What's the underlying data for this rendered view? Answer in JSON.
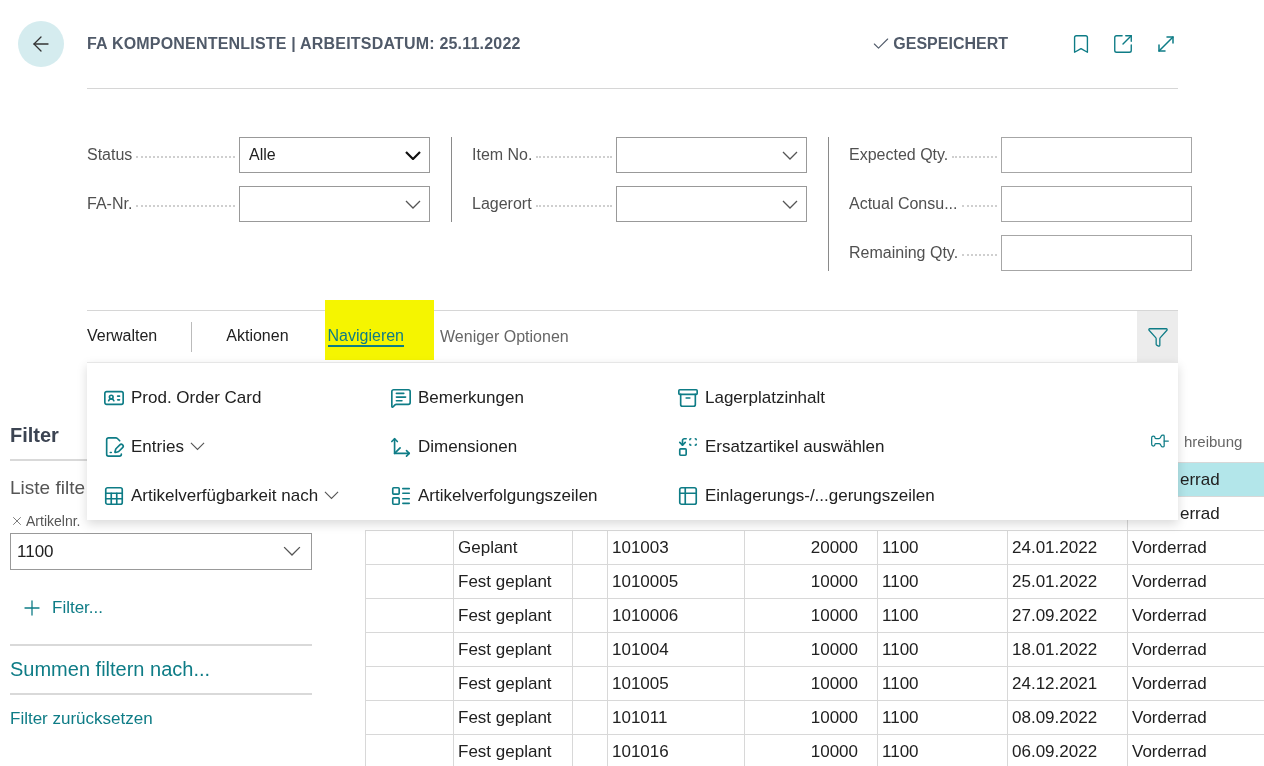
{
  "header": {
    "title": "FA KOMPONENTENLISTE | ARBEITSDATUM: 25.11.2022",
    "save_status": "GESPEICHERT"
  },
  "field_groups": [
    [
      {
        "label": "Status",
        "kind": "select",
        "value": "Alle"
      },
      {
        "label": "FA-Nr.",
        "kind": "select"
      }
    ],
    [
      {
        "label": "Item No.",
        "kind": "select"
      },
      {
        "label": "Lagerort",
        "kind": "select"
      }
    ],
    [
      {
        "label": "Expected Qty.",
        "kind": "text"
      },
      {
        "label": "Actual Consu...",
        "kind": "text"
      },
      {
        "label": "Remaining Qty.",
        "kind": "text"
      }
    ]
  ],
  "action_tabs": [
    {
      "label": "Verwalten",
      "selected": false,
      "highlighted": false
    },
    {
      "label": "Aktionen",
      "selected": false,
      "highlighted": false
    },
    {
      "label": "Navigieren",
      "selected": true,
      "highlighted": true
    }
  ],
  "less_options": "Weniger Optionen",
  "menu": {
    "columns": [
      [
        {
          "label": "Prod. Order Card",
          "expandable": false
        },
        {
          "label": "Entries",
          "expandable": true
        },
        {
          "label": "Artikelverfügbarkeit nach",
          "expandable": true
        }
      ],
      [
        {
          "label": "Bemerkungen",
          "expandable": false
        },
        {
          "label": "Dimensionen",
          "expandable": false
        },
        {
          "label": "Artikelverfolgungszeilen",
          "expandable": false
        }
      ],
      [
        {
          "label": "Lagerplatzinhalt",
          "expandable": false
        },
        {
          "label": "Ersatzartikel auswählen",
          "expandable": false
        },
        {
          "label": "Einlagerungs-/...gerungszeilen",
          "expandable": false
        }
      ]
    ]
  },
  "filter_pane": {
    "title": "Filter",
    "list_filter": "Liste filte",
    "filter_field": {
      "label": "Artikelnr.",
      "value": "1100"
    },
    "add_filter": "Filter...",
    "totals": "Summen filtern nach...",
    "reset": "Filter zurücksetzen"
  },
  "table": {
    "column_8_header": "hreibung",
    "rows": [
      {
        "selected": true,
        "cells": {
          "column_8": "errad"
        }
      },
      {
        "selected": false,
        "cells": {
          "column_8": "errad"
        }
      },
      {
        "selected": false,
        "cells": {
          "column_2": "Geplant",
          "column_4": "101003",
          "column_5": "20000",
          "column_6": "1100",
          "column_7": "24.01.2022",
          "column_8": "Vorderrad"
        }
      },
      {
        "selected": false,
        "cells": {
          "column_2": "Fest geplant",
          "column_4": "1010005",
          "column_5": "10000",
          "column_6": "1100",
          "column_7": "25.01.2022",
          "column_8": "Vorderrad"
        }
      },
      {
        "selected": false,
        "cells": {
          "column_2": "Fest geplant",
          "column_4": "1010006",
          "column_5": "10000",
          "column_6": "1100",
          "column_7": "27.09.2022",
          "column_8": "Vorderrad"
        }
      },
      {
        "selected": false,
        "cells": {
          "column_2": "Fest geplant",
          "column_4": "101004",
          "column_5": "10000",
          "column_6": "1100",
          "column_7": "18.01.2022",
          "column_8": "Vorderrad"
        }
      },
      {
        "selected": false,
        "cells": {
          "column_2": "Fest geplant",
          "column_4": "101005",
          "column_5": "10000",
          "column_6": "1100",
          "column_7": "24.12.2021",
          "column_8": "Vorderrad"
        }
      },
      {
        "selected": false,
        "cells": {
          "column_2": "Fest geplant",
          "column_4": "101011",
          "column_5": "10000",
          "column_6": "1100",
          "column_7": "08.09.2022",
          "column_8": "Vorderrad"
        }
      },
      {
        "selected": false,
        "cells": {
          "column_2": "Fest geplant",
          "column_4": "101016",
          "column_5": "10000",
          "column_6": "1100",
          "column_7": "06.09.2022",
          "column_8": "Vorderrad"
        }
      }
    ]
  }
}
